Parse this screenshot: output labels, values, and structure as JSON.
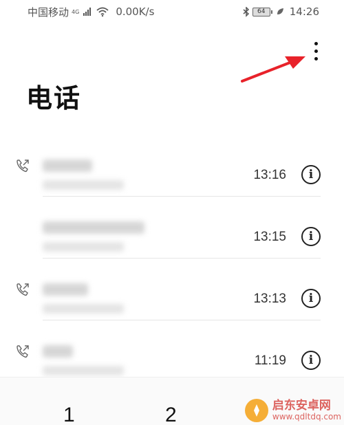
{
  "status_bar": {
    "carrier": "中国移动",
    "network_badge": "4G",
    "speed": "0.00K/s",
    "battery": "64",
    "time": "14:26",
    "icons": [
      "signal-icon",
      "wifi-icon",
      "bluetooth-icon",
      "battery-icon",
      "leaf-icon"
    ]
  },
  "header": {
    "title": "电话",
    "more_icon": "more-vertical-icon"
  },
  "calls": [
    {
      "time": "13:16",
      "outgoing": true
    },
    {
      "time": "13:15",
      "outgoing": false
    },
    {
      "time": "13:13",
      "outgoing": true
    },
    {
      "time": "11:19",
      "outgoing": true
    }
  ],
  "keypad": {
    "keys": [
      "1",
      "2"
    ]
  },
  "watermark": {
    "title": "启东安卓网",
    "url": "www.qdltdq.com"
  },
  "colors": {
    "annotation_arrow": "#e8222a",
    "watermark": "#d9534f",
    "watermark_logo": "#f5a623"
  }
}
